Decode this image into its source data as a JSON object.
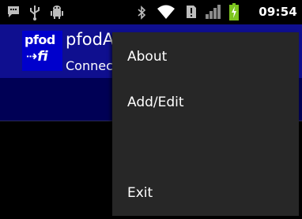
{
  "statusbar": {
    "time": "09:54",
    "icons": [
      "chat-icon",
      "usb-icon",
      "android-debug-icon",
      "bluetooth-icon",
      "wifi-icon",
      "no-sim-icon",
      "signal-icon",
      "battery-charging-icon"
    ]
  },
  "app": {
    "logo_top": "pfod",
    "logo_bottom": "fi",
    "title": "pfodA",
    "subtitle": "Connec"
  },
  "menu": {
    "items": [
      {
        "label": "About"
      },
      {
        "label": "Add/Edit"
      },
      {
        "label": "Exit"
      }
    ]
  },
  "colors": {
    "appbar": "#0f0f8f",
    "menu_bg": "#272727",
    "logo_bg": "#0000cc",
    "battery": "#7dc51f"
  }
}
